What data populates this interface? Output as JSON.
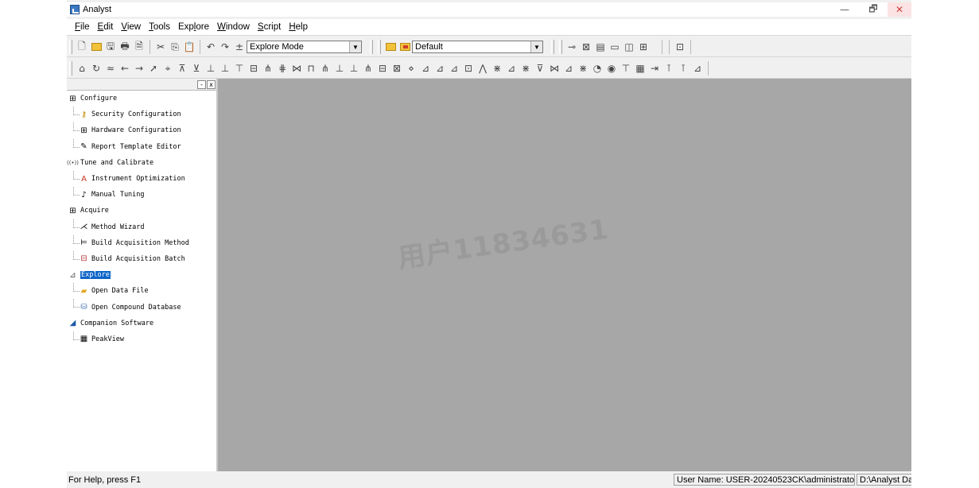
{
  "window": {
    "title": "Analyst",
    "minimize_glyph": "—",
    "restore_glyph": "🗗",
    "close_glyph": "✕"
  },
  "menubar": [
    {
      "label": "File",
      "mnemonic": "F",
      "rest": "ile"
    },
    {
      "label": "Edit",
      "mnemonic": "E",
      "rest": "dit"
    },
    {
      "label": "View",
      "mnemonic": "V",
      "rest": "iew"
    },
    {
      "label": "Tools",
      "mnemonic": "T",
      "rest": "ools"
    },
    {
      "label": "Explore",
      "pre": "Exp",
      "mnemonic": "l",
      "rest": "ore"
    },
    {
      "label": "Window",
      "mnemonic": "W",
      "rest": "indow"
    },
    {
      "label": "Script",
      "mnemonic": "S",
      "rest": "cript"
    },
    {
      "label": "Help",
      "mnemonic": "H",
      "rest": "elp"
    }
  ],
  "toolbar1": {
    "mode_select": {
      "value": "Explore Mode"
    },
    "layout_select": {
      "value": "Default"
    }
  },
  "tree": {
    "pane_min_glyph": "-",
    "pane_close_glyph": "x",
    "groups": [
      {
        "label": "Configure",
        "icon": "grid-icon",
        "children": [
          {
            "label": "Security Configuration",
            "icon": "key-icon"
          },
          {
            "label": "Hardware Configuration",
            "icon": "hardware-icon"
          },
          {
            "label": "Report Template Editor",
            "icon": "report-icon"
          }
        ]
      },
      {
        "label": "Tune and Calibrate",
        "icon": "signal-icon",
        "children": [
          {
            "label": "Instrument Optimization",
            "icon": "optimize-icon"
          },
          {
            "label": "Manual Tuning",
            "icon": "tuning-icon"
          }
        ]
      },
      {
        "label": "Acquire",
        "icon": "acquire-icon",
        "children": [
          {
            "label": "Method Wizard",
            "icon": "wand-icon"
          },
          {
            "label": "Build Acquisition Method",
            "icon": "method-icon"
          },
          {
            "label": "Build Acquisition Batch",
            "icon": "batch-icon"
          }
        ]
      },
      {
        "label": "Explore",
        "icon": "explore-icon",
        "selected": true,
        "children": [
          {
            "label": "Open Data File",
            "icon": "folder-open-icon"
          },
          {
            "label": "Open Compound Database",
            "icon": "database-icon"
          }
        ]
      },
      {
        "label": "Companion Software",
        "icon": "companion-icon",
        "children": [
          {
            "label": "PeakView",
            "icon": "peakview-icon"
          }
        ]
      }
    ]
  },
  "watermark": "用户11834631",
  "statusbar": {
    "help": "For Help, press F1",
    "user": "User Name: USER-20240523CK\\administrator",
    "path": "D:\\Analyst Da"
  },
  "colors": {
    "selection": "#0a64c8",
    "workspace": "#a7a7a7"
  }
}
